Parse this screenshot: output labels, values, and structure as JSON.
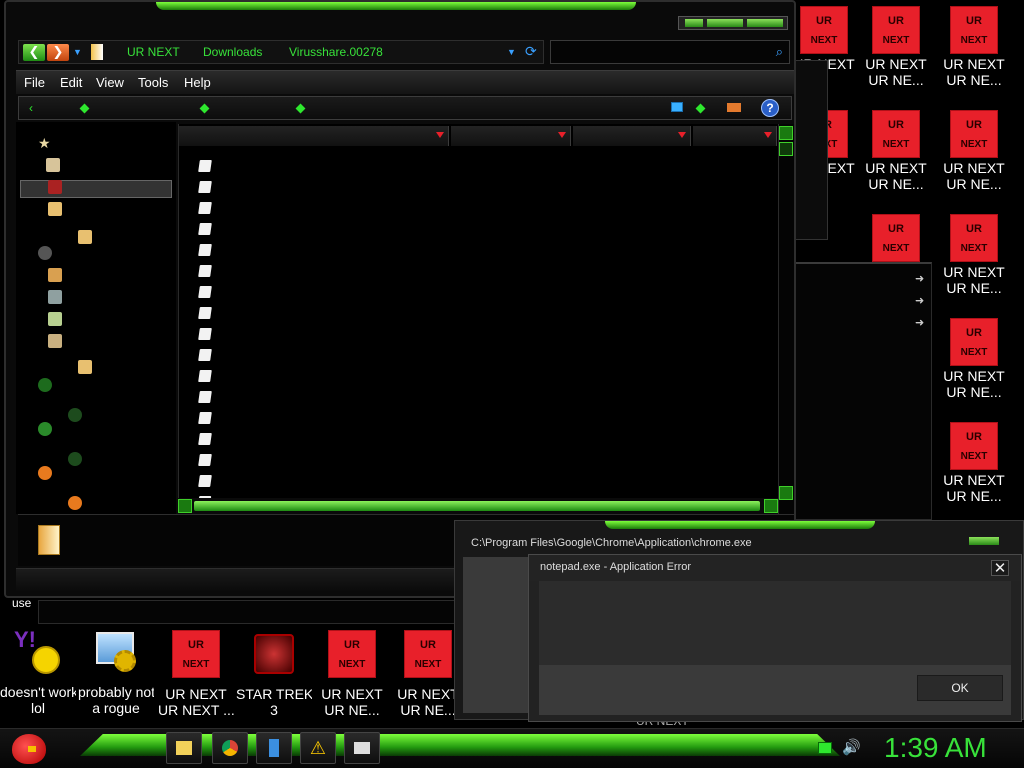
{
  "explorer": {
    "breadcrumb": [
      "UR NEXT",
      "Downloads",
      "Virusshare.00278"
    ],
    "menu": [
      "File",
      "Edit",
      "View",
      "Tools",
      "Help"
    ]
  },
  "desktop_right_icons": [
    {
      "tile_top": "UR",
      "tile_bottom": "NEXT",
      "line1": "UR NEXT",
      "line2": "UR NE..."
    }
  ],
  "desktop_bottom_icons": [
    {
      "icon": "yahoo-messenger-icon",
      "line1": "doesn't work",
      "line2": "lol"
    },
    {
      "icon": "gears-icon",
      "line1": "probably not",
      "line2": "a rogue"
    },
    {
      "icon": "ur-next-icon",
      "line1": "UR NEXT",
      "line2": "UR NEXT ..."
    },
    {
      "icon": "star-trek-icon",
      "line1": "STAR TREK",
      "line2": "3"
    },
    {
      "icon": "ur-next-icon",
      "line1": "UR NEXT",
      "line2": "UR NE..."
    },
    {
      "icon": "ur-next-icon",
      "line1": "UR NEXT",
      "line2": "UR NE..."
    }
  ],
  "partial_label": "use",
  "chrome_error": {
    "title": "C:\\Program Files\\Google\\Chrome\\Application\\chrome.exe"
  },
  "notepad_error": {
    "title": "notepad.exe - Application Error",
    "ok_label": "OK",
    "close_glyph": "✕"
  },
  "hidden_label": "UR NEXT",
  "taskbar": {
    "clock": "1:39 AM",
    "accent": "#38e23a"
  }
}
